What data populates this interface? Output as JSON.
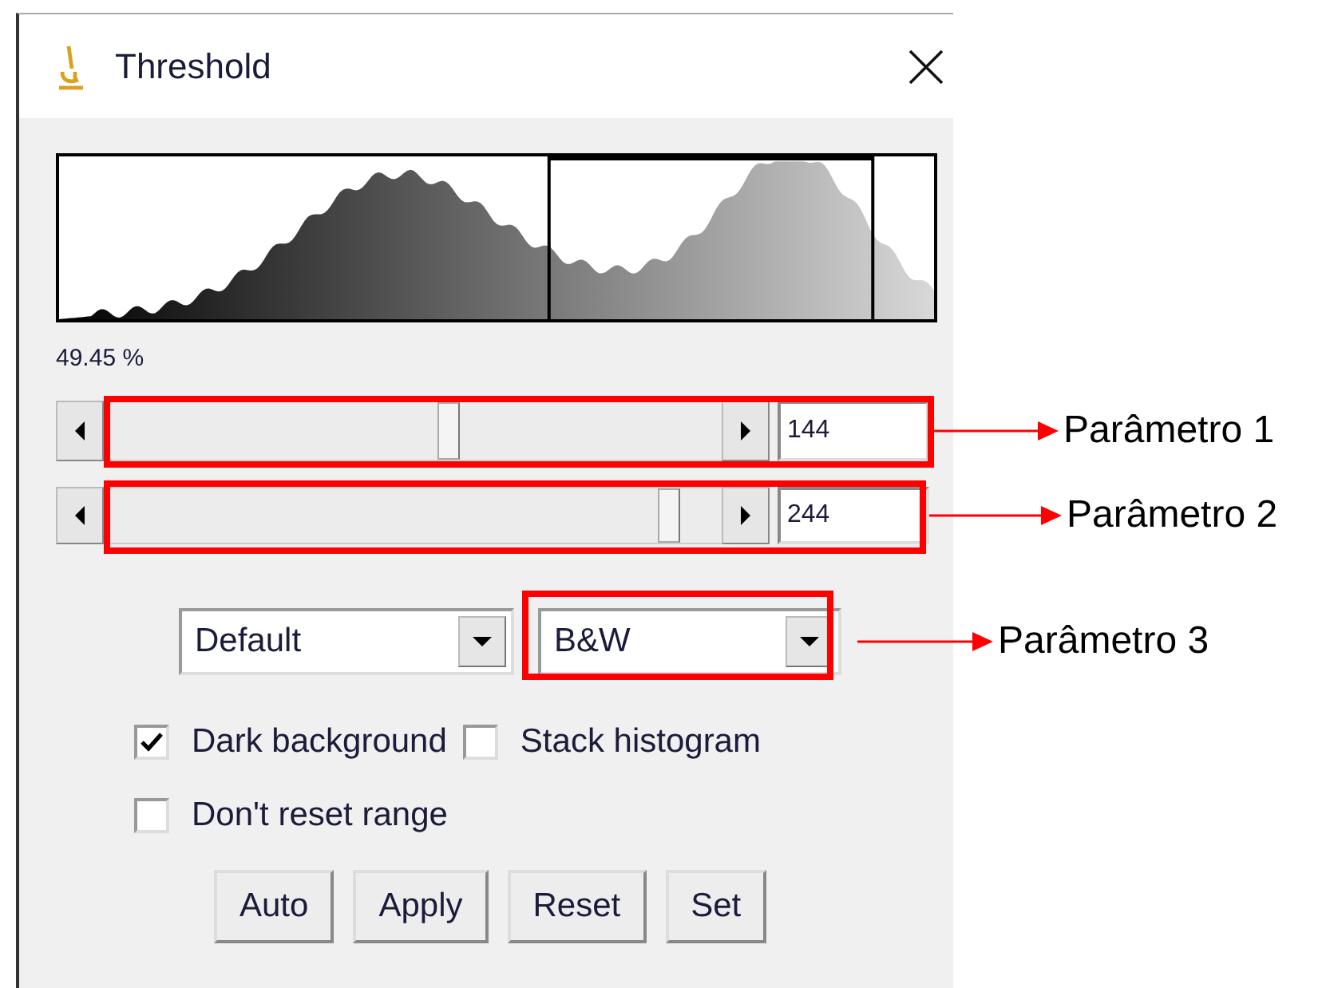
{
  "window": {
    "title": "Threshold"
  },
  "percent": "49.45 %",
  "sliders": [
    {
      "level": 0.56,
      "value": "144",
      "annotation": "Parâmetro 1"
    },
    {
      "level": 0.93,
      "value": "244",
      "annotation": "Parâmetro 2"
    }
  ],
  "dropdowns": [
    {
      "value": "Default"
    },
    {
      "value": "B&W",
      "annotation": "Parâmetro 3"
    }
  ],
  "checkbox_rows": [
    [
      {
        "label": "Dark background",
        "checked": true
      },
      {
        "label": "Stack histogram",
        "checked": false
      }
    ],
    [
      {
        "label": "Don't reset range",
        "checked": false
      }
    ]
  ],
  "buttons": [
    "Auto",
    "Apply",
    "Reset",
    "Set"
  ]
}
